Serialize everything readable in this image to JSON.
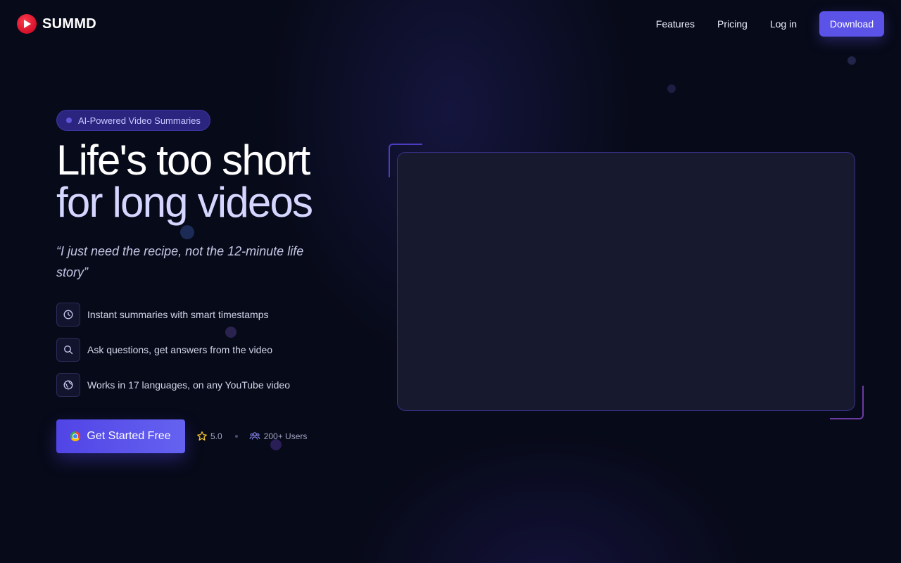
{
  "brand": {
    "name": "SUMMD",
    "logo_icon": "play-icon",
    "logo_color": "#e0142e"
  },
  "nav": {
    "links": [
      "Features",
      "Pricing",
      "Log in"
    ],
    "download_label": "Download"
  },
  "hero": {
    "badge": "AI-Powered Video Summaries",
    "headline_line1": "Life's too short",
    "headline_line2": "for long videos",
    "quote": "“I just need the recipe, not the 12-minute life story”",
    "features": [
      {
        "icon": "clock-icon",
        "text": "Instant summaries with smart timestamps"
      },
      {
        "icon": "search-icon",
        "text": "Ask questions, get answers from the video"
      },
      {
        "icon": "globe-icon",
        "text": "Works in 17 languages, on any YouTube video"
      }
    ],
    "cta_label": "Get Started Free",
    "cta_icon": "chrome-icon",
    "rating": "5.0",
    "users": "200+ Users"
  },
  "colors": {
    "background": "#070a18",
    "accent": "#5b52e8",
    "badge_bg": "#2c2580",
    "headline_secondary": "#d4d6ff",
    "star": "#f2c230"
  }
}
